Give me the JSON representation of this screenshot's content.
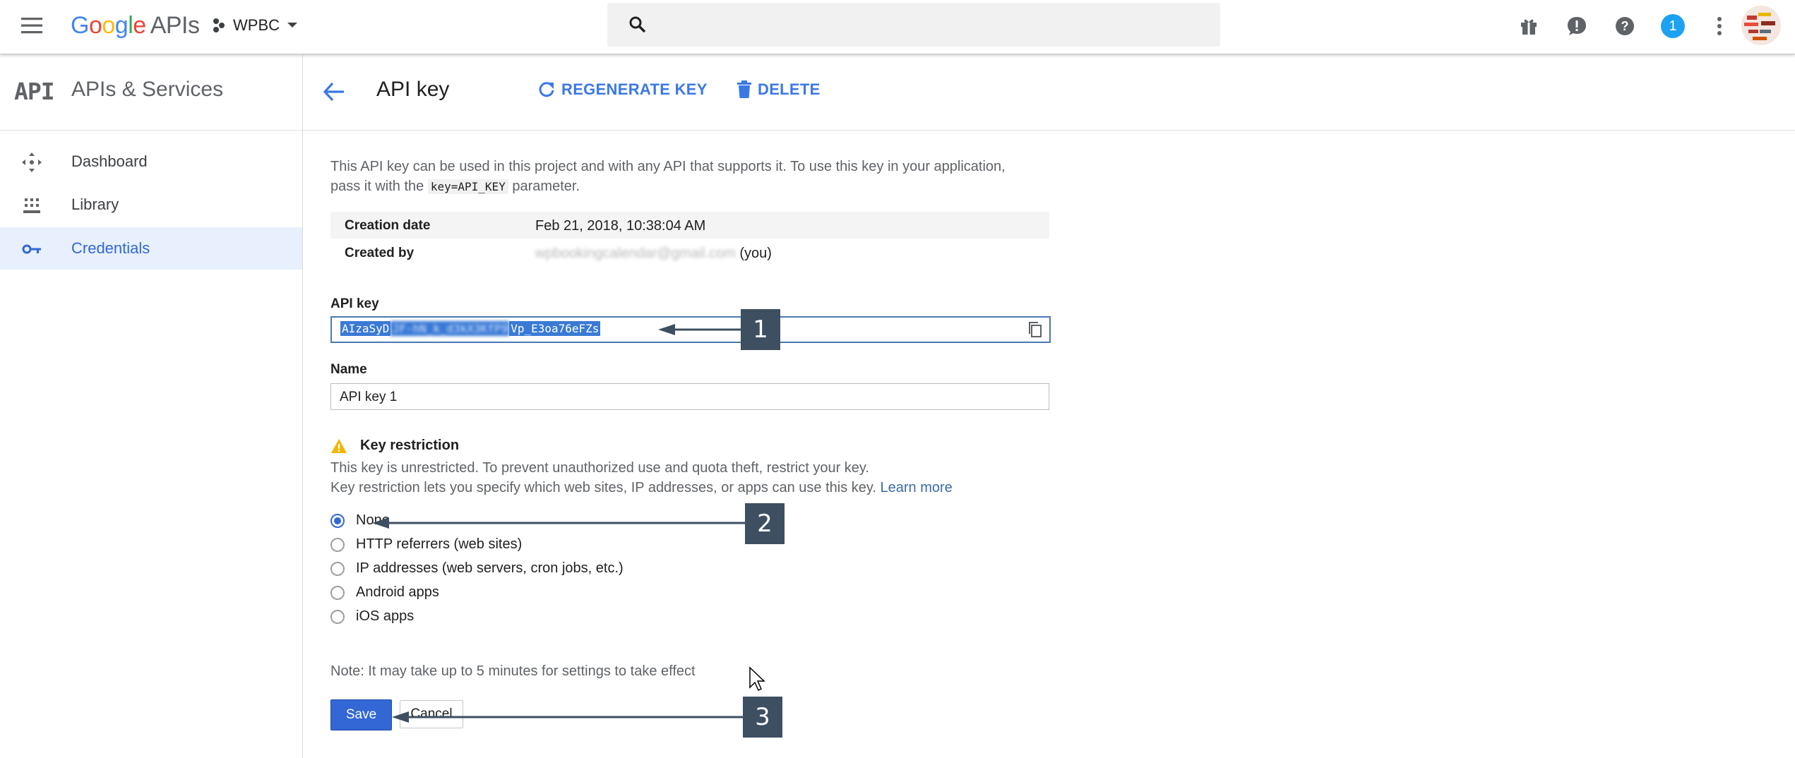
{
  "topbar": {
    "logo_google": "Google",
    "logo_apis": "APIs",
    "project": "WPBC",
    "notification_count": "1",
    "icons": [
      "menu-icon",
      "search-icon",
      "gift-icon",
      "feedback-icon",
      "help-icon",
      "notifications-icon",
      "more-vert-icon"
    ]
  },
  "sidebar": {
    "api_mark": "API",
    "title": "APIs & Services",
    "items": [
      {
        "label": "Dashboard",
        "icon": "dashboard-icon"
      },
      {
        "label": "Library",
        "icon": "library-icon"
      },
      {
        "label": "Credentials",
        "icon": "key-icon",
        "active": true
      }
    ]
  },
  "header": {
    "title": "API key",
    "regenerate_label": "REGENERATE KEY",
    "delete_label": "DELETE"
  },
  "content": {
    "description_line1": "This API key can be used in this project and with any API that supports it. To use this key in your application,",
    "description_pre": "pass it with the",
    "description_code": "key=API_KEY",
    "description_post": "parameter.",
    "meta": [
      {
        "key": "Creation date",
        "value": "Feb 21, 2018, 10:38:04 AM"
      },
      {
        "key": "Created by",
        "value_blurred": "wpbookingcalendar@gmail.com",
        "value_suffix": "(you)"
      }
    ],
    "api_key_label": "API key",
    "api_key_prefix": "AIzaSyD",
    "api_key_blurred": "JF-hN_k_d3kX3KfP9",
    "api_key_suffix": "Vp_E3oa76eFZs",
    "name_label": "Name",
    "name_value": "API key 1",
    "restriction_title": "Key restriction",
    "restriction_note1": "This key is unrestricted. To prevent unauthorized use and quota theft, restrict your key.",
    "restriction_note2": "Key restriction lets you specify which web sites, IP addresses, or apps can use this key.",
    "learn_more": "Learn more",
    "options": [
      {
        "label": "None",
        "selected": true
      },
      {
        "label": "HTTP referrers (web sites)",
        "selected": false
      },
      {
        "label": "IP addresses (web servers, cron jobs, etc.)",
        "selected": false
      },
      {
        "label": "Android apps",
        "selected": false
      },
      {
        "label": "iOS apps",
        "selected": false
      }
    ],
    "note_effect": "Note: It may take up to 5 minutes for settings to take effect",
    "save_label": "Save",
    "cancel_label": "Cancel"
  },
  "callouts": [
    "1",
    "2",
    "3"
  ],
  "colors": {
    "accent": "#3367d6",
    "callout_bg": "#3d4f61",
    "warning": "#f4b400"
  }
}
